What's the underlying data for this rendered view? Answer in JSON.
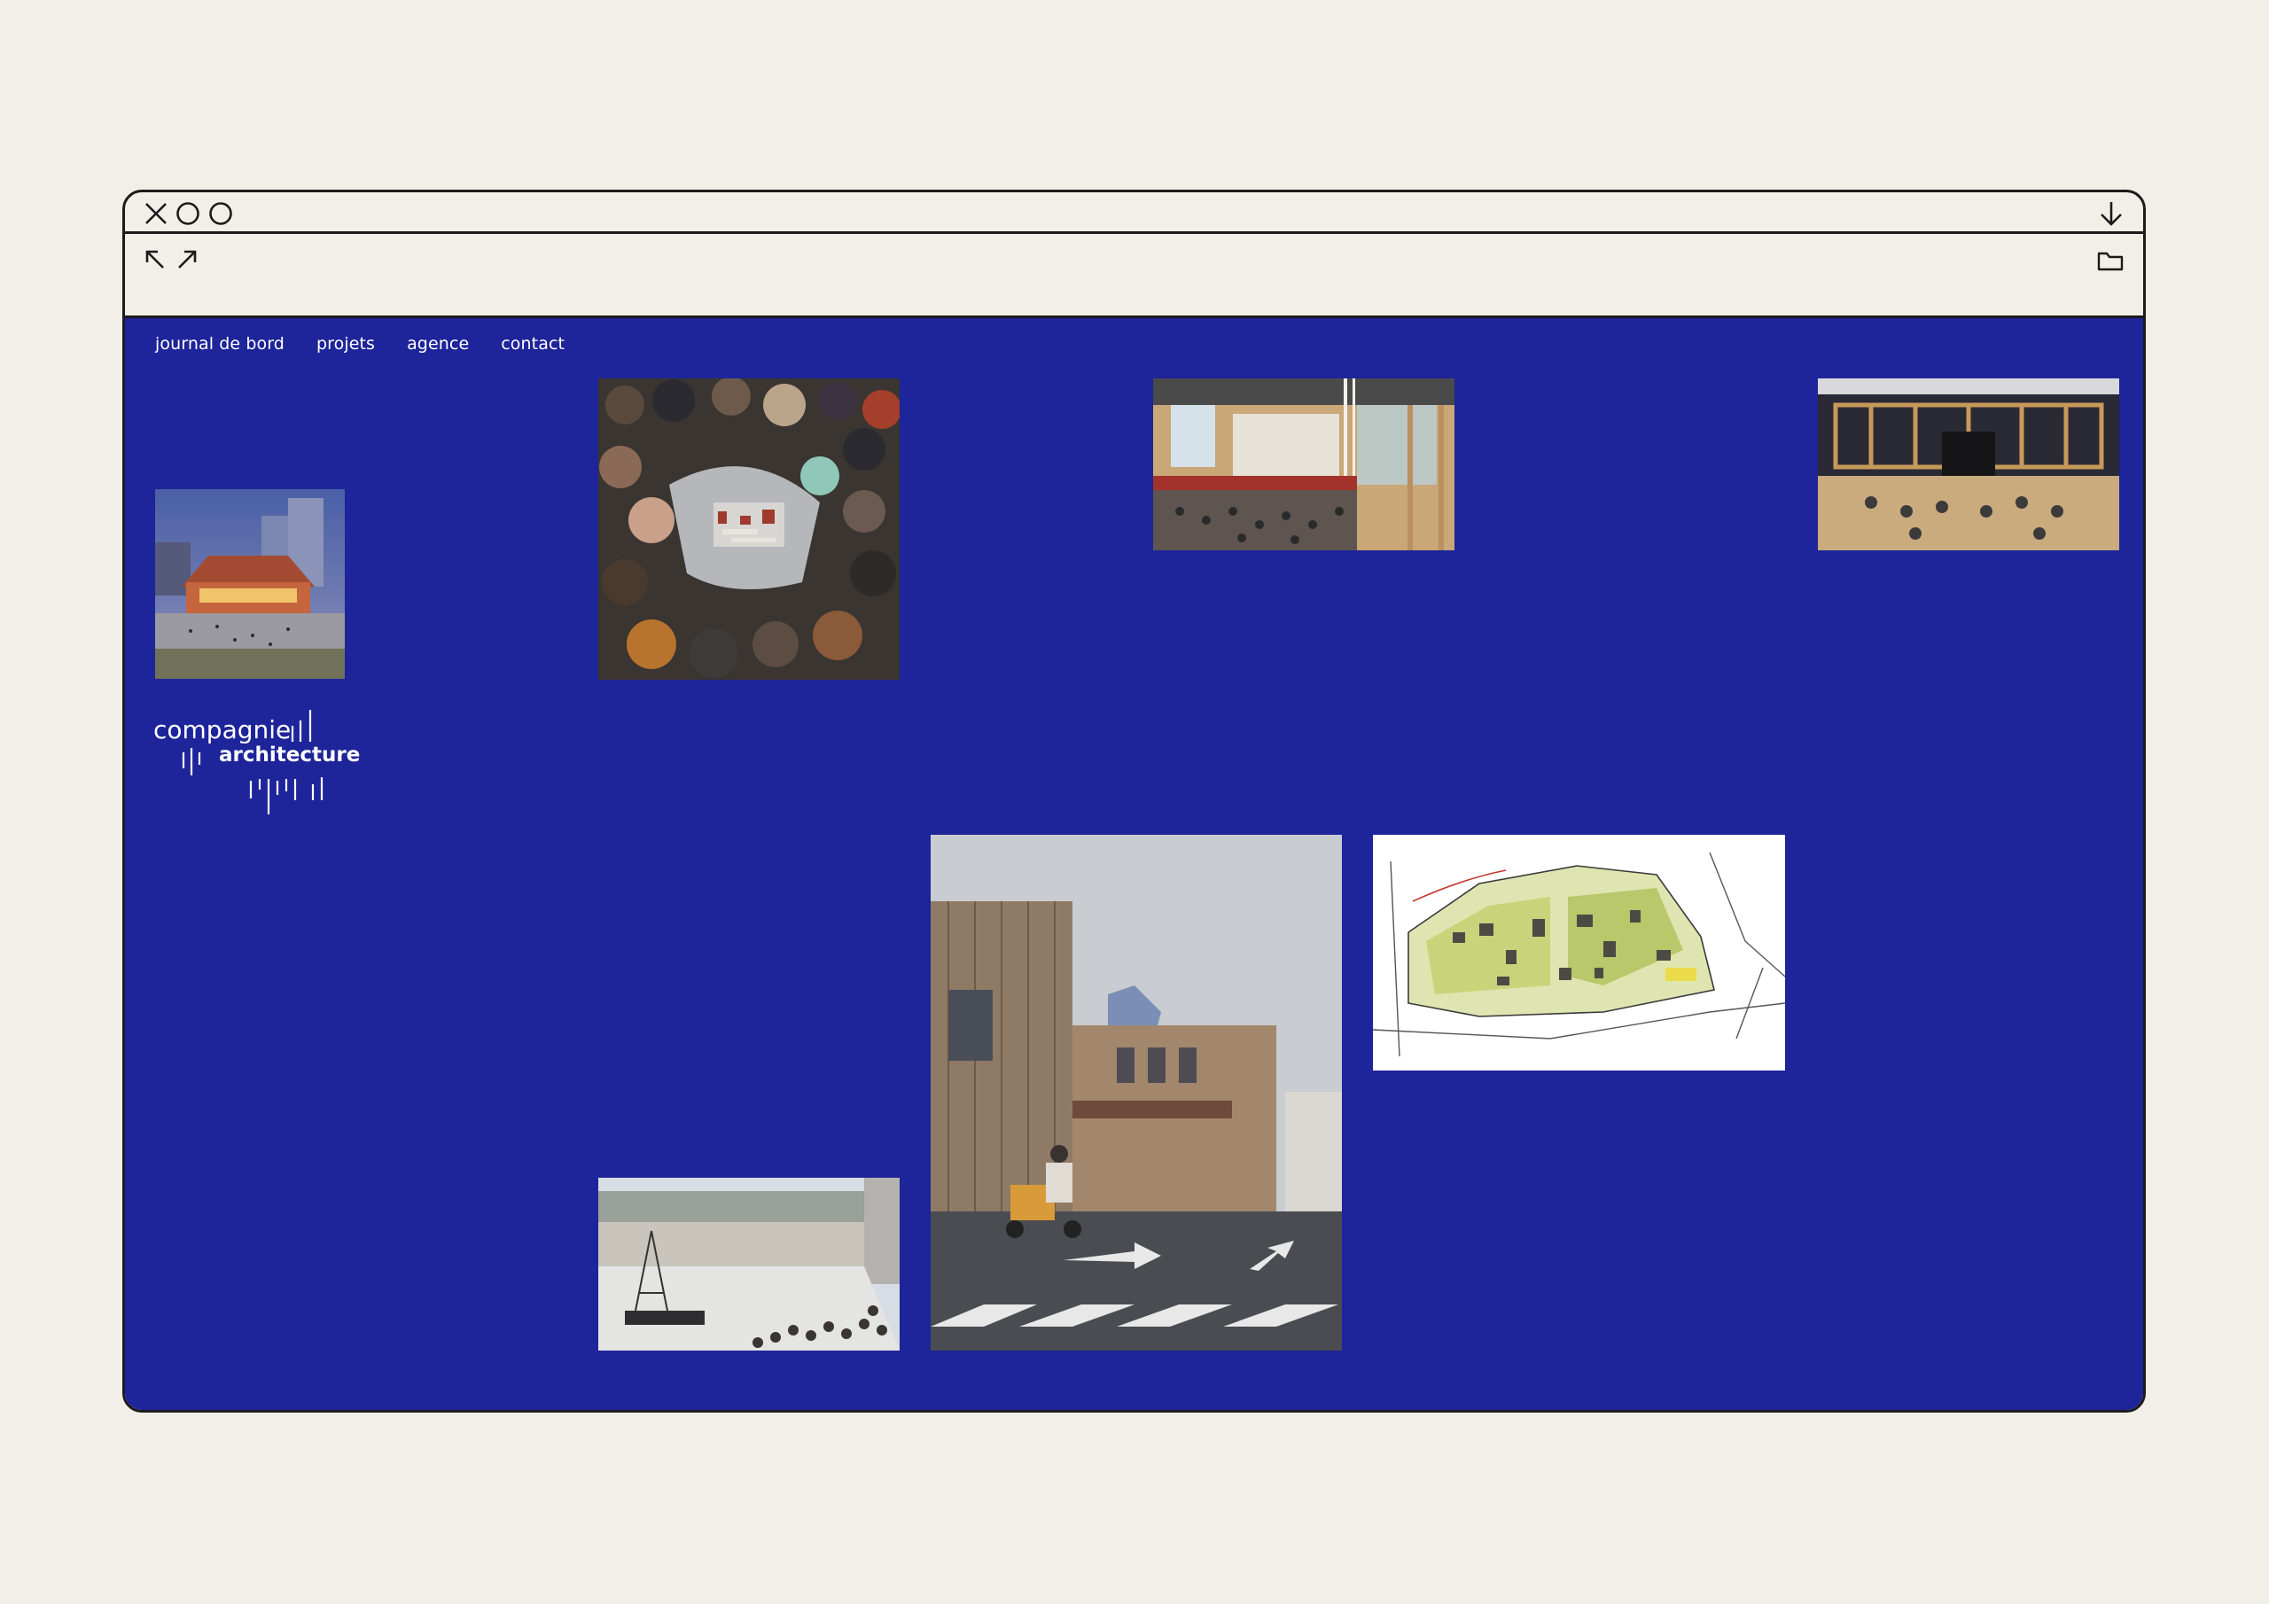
{
  "nav": {
    "items": [
      "journal de bord",
      "projets",
      "agence",
      "contact"
    ]
  },
  "logo": {
    "line1": "compagnie",
    "line2": "architecture"
  },
  "icons": {
    "close": "close-icon",
    "minimize": "circle-icon",
    "maximize": "circle-icon",
    "download": "arrow-down-icon",
    "expand_left": "arrow-up-left-icon",
    "expand_right": "arrow-up-right-icon",
    "folder": "folder-icon"
  },
  "colors": {
    "page_background": "#f2efe8",
    "site_background": "#1e2499",
    "text": "#ffffff",
    "frame": "#1b1b1b"
  }
}
